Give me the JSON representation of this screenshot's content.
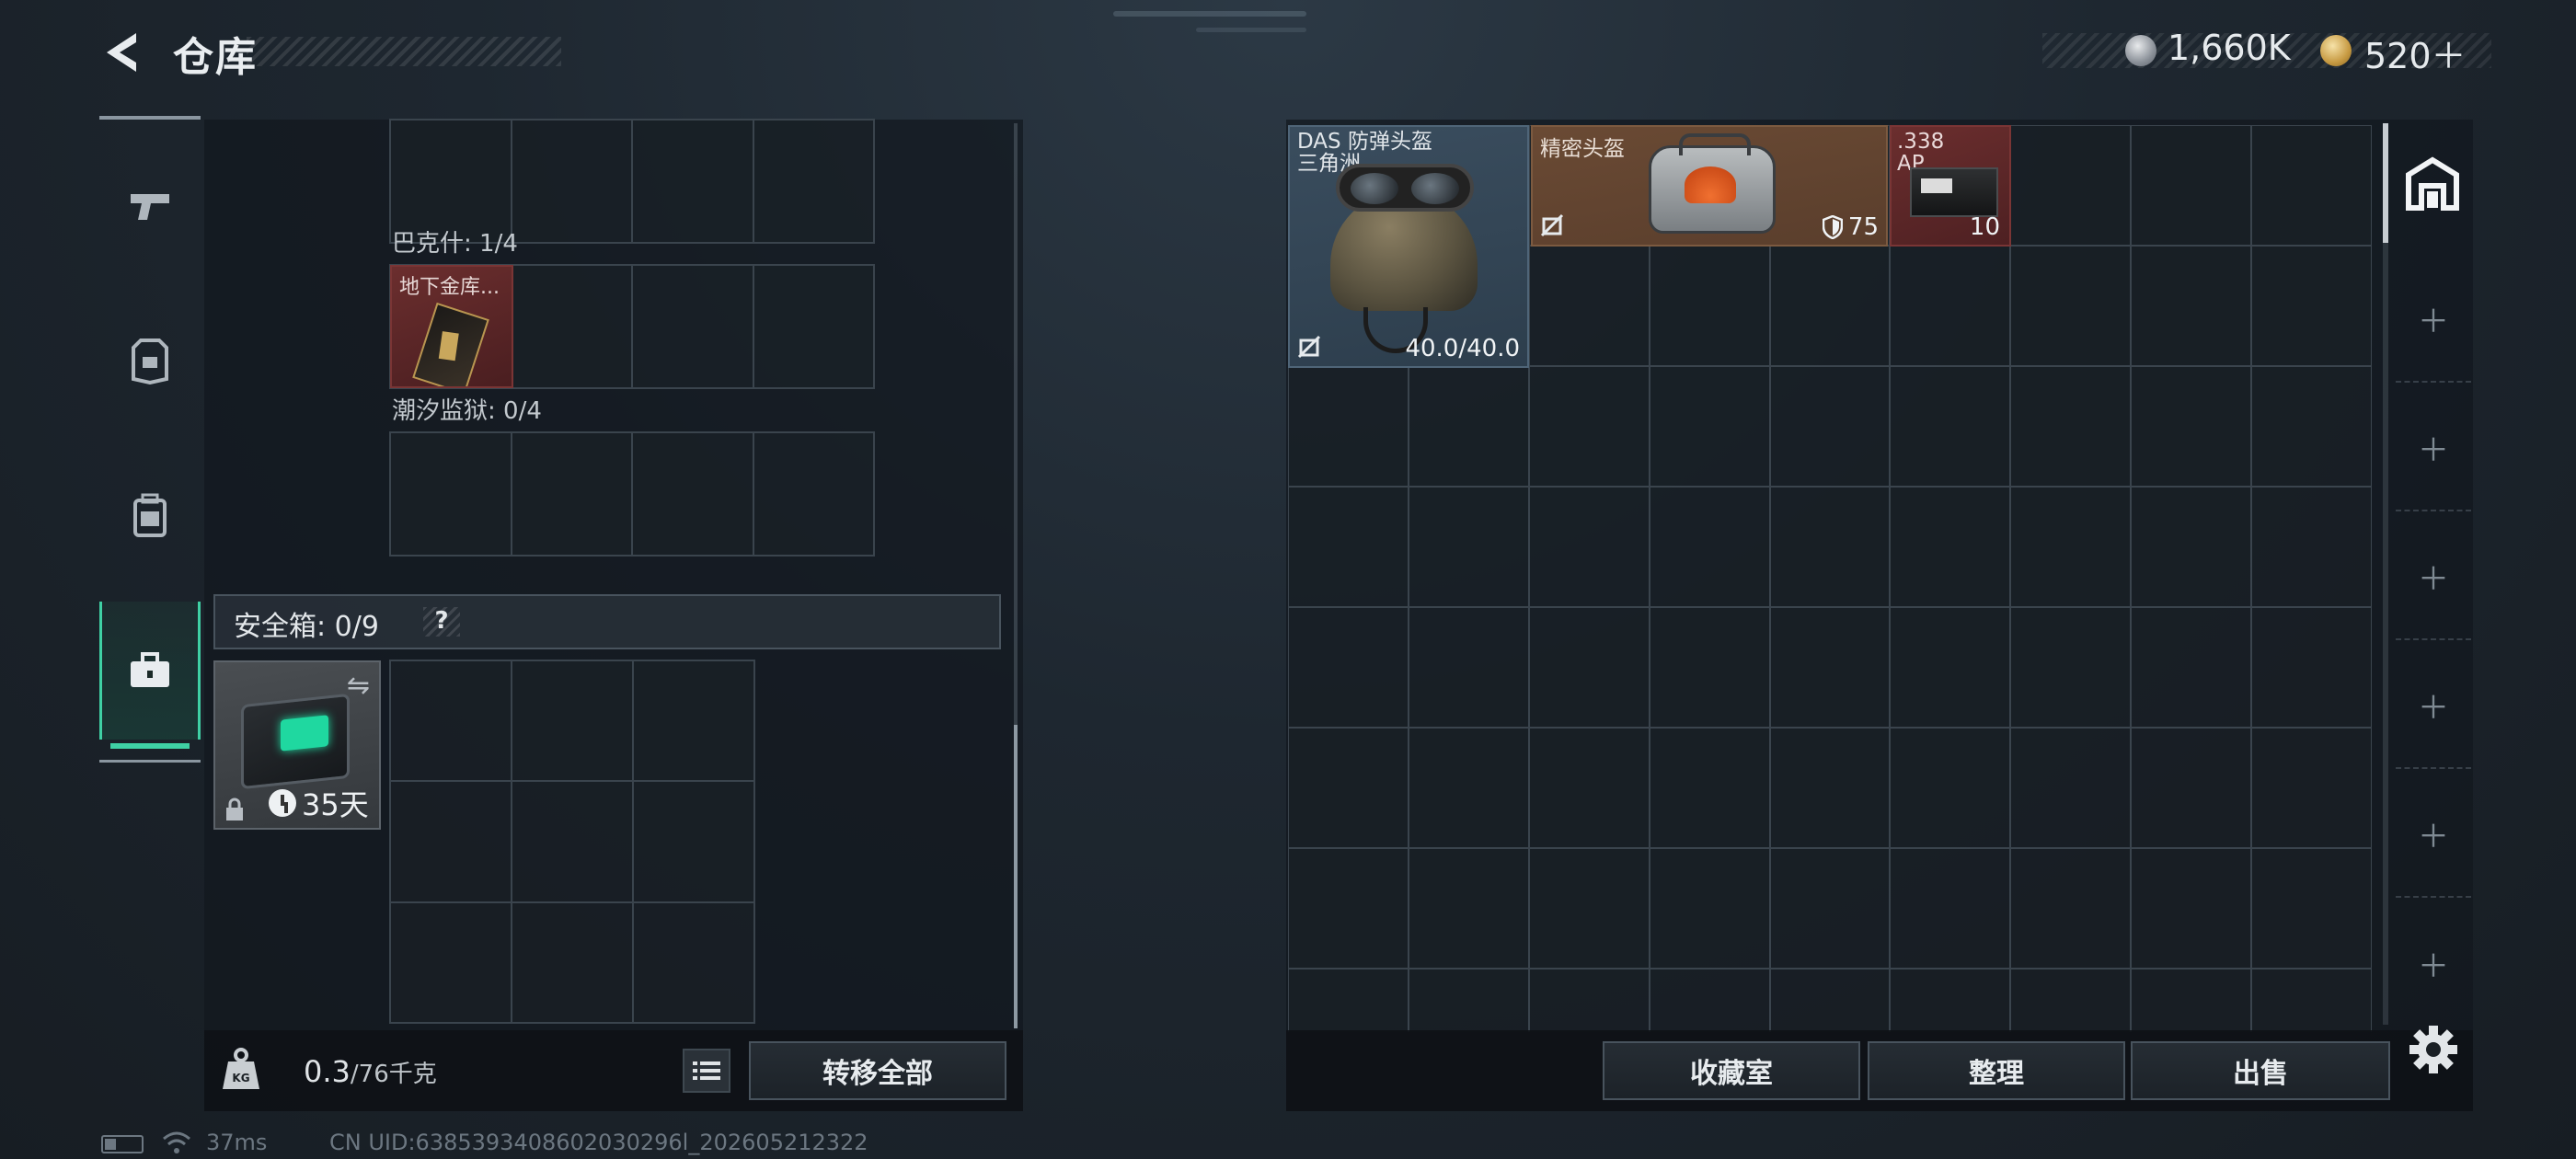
{
  "header": {
    "title": "仓库",
    "currency_silver": "1,660K",
    "currency_gold": "520＋"
  },
  "left_rail": {
    "items": [
      "pistol-icon",
      "armor-icon",
      "backpack-icon",
      "toolbox-icon"
    ],
    "active": "toolbox-icon"
  },
  "stash": {
    "section_bakesh": "巴克什: 1/4",
    "map_item_label": "地下金库...",
    "section_tide_prison": "潮汐监狱: 0/4"
  },
  "safe_box": {
    "title": "安全箱: 0/9",
    "help": "?",
    "item_time": "35天"
  },
  "left_bottom": {
    "weight_current": "0.3",
    "weight_max": "/76千克",
    "transfer_all": "转移全部"
  },
  "inventory": {
    "helmet_name_line1": "DAS 防弹头盔",
    "helmet_name_line2": "三角洲",
    "helmet_durability": "40.0/40.0",
    "precise_name": "精密头盔",
    "precise_armor": "75",
    "ammo_name_line1": ".338",
    "ammo_name_line2": "AP",
    "ammo_count": "10"
  },
  "right_bottom": {
    "collection": "收藏室",
    "sort": "整理",
    "sell": "出售"
  },
  "status_bar": {
    "ping": "37ms",
    "uid": "CN UID:6385393408602030296l_202605212322"
  },
  "colors": {
    "accent": "#3fd0a4",
    "item_red": "#6b2e2e",
    "item_blue": "#3a4d5e",
    "item_brown": "#6a4a34"
  }
}
